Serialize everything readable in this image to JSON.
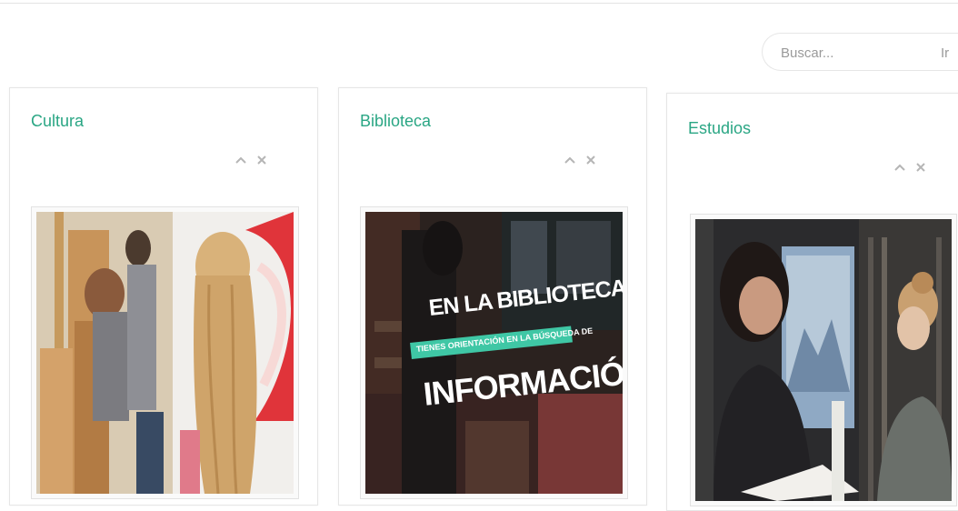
{
  "search": {
    "placeholder": "Buscar...",
    "button_label": "Ir"
  },
  "panels": [
    {
      "title": "Cultura",
      "image_alt": "Estudiantes pintando en un taller de arte"
    },
    {
      "title": "Biblioteca",
      "image_alt": "Biblioteca"
    },
    {
      "title": "Estudios",
      "image_alt": "Estudiantes leyendo en la biblioteca"
    }
  ],
  "biblioteca_image_text": {
    "line1": "EN LA BIBLIOTECA",
    "line2": "TIENES ORIENTACIÓN EN LA BÚSQUEDA DE",
    "line3": "INFORMACIÓN"
  },
  "colors": {
    "accent": "#2aa684",
    "band": "#3fc7a5",
    "control": "#b5b5b5"
  },
  "icons": {
    "collapse": "chevron-up-icon",
    "close": "close-icon"
  }
}
